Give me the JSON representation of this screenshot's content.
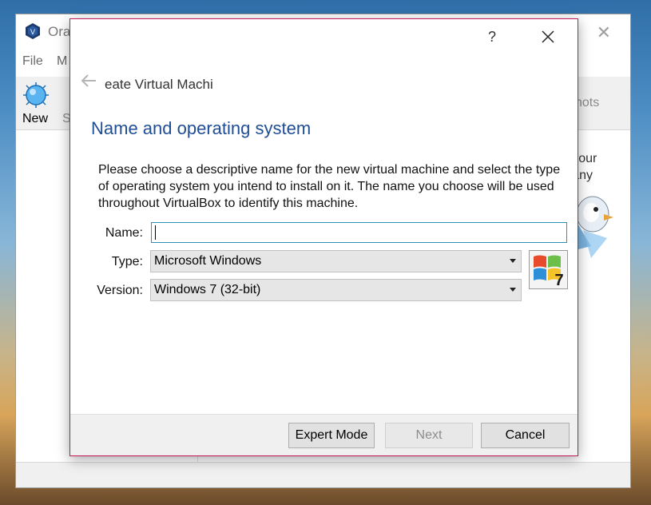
{
  "manager": {
    "title": "Ora",
    "menu": [
      "File",
      "M"
    ],
    "toolbar": {
      "new_label": "New",
      "s_label": "S",
      "snapshots_label": "hots"
    },
    "welcome_text": "on your\ned any"
  },
  "dialog": {
    "help_label": "?",
    "breadcrumb": "eate Virtual Machi",
    "heading": "Name and operating system",
    "description": "Please choose a descriptive name for the new virtual machine and select the type of operating system you intend to install on it. The name you choose will be used throughout VirtualBox to identify this machine.",
    "name_label": "Name:",
    "name_value": "",
    "type_label": "Type:",
    "type_value": "Microsoft Windows",
    "version_label": "Version:",
    "version_value": "Windows 7 (32-bit)",
    "os_icon": "windows-7-icon",
    "buttons": {
      "expert": "Expert Mode",
      "next": "Next",
      "cancel": "Cancel"
    }
  },
  "colors": {
    "heading": "#1f4e96",
    "dialog_border": "#c2185b",
    "input_focus": "#2f8fb8"
  }
}
